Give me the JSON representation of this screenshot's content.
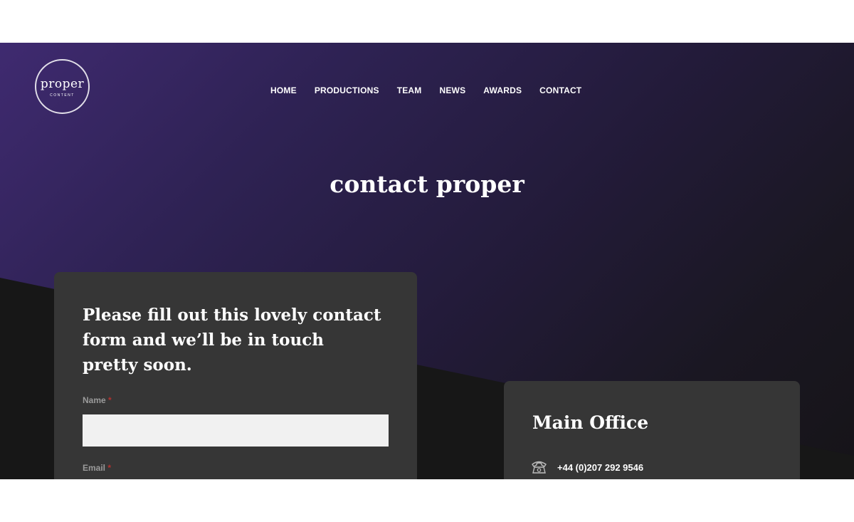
{
  "logo": {
    "word": "proper",
    "sub": "CONTENT"
  },
  "nav": {
    "items": [
      "HOME",
      "PRODUCTIONS",
      "TEAM",
      "NEWS",
      "AWARDS",
      "CONTACT"
    ]
  },
  "hero": {
    "title": "contact proper"
  },
  "form": {
    "heading": "Please fill out this lovely contact form and we’ll be in touch pretty soon.",
    "name_label": "Name",
    "email_label": "Email",
    "required_mark": "*",
    "name_value": ""
  },
  "office": {
    "title": "Main Office",
    "phone": "+44 (0)207 292 9546",
    "phone_icon": "phone-icon"
  },
  "colors": {
    "accent_required": "#b2312e",
    "hero_purple": "#3f2a70",
    "card_bg": "#363636"
  }
}
